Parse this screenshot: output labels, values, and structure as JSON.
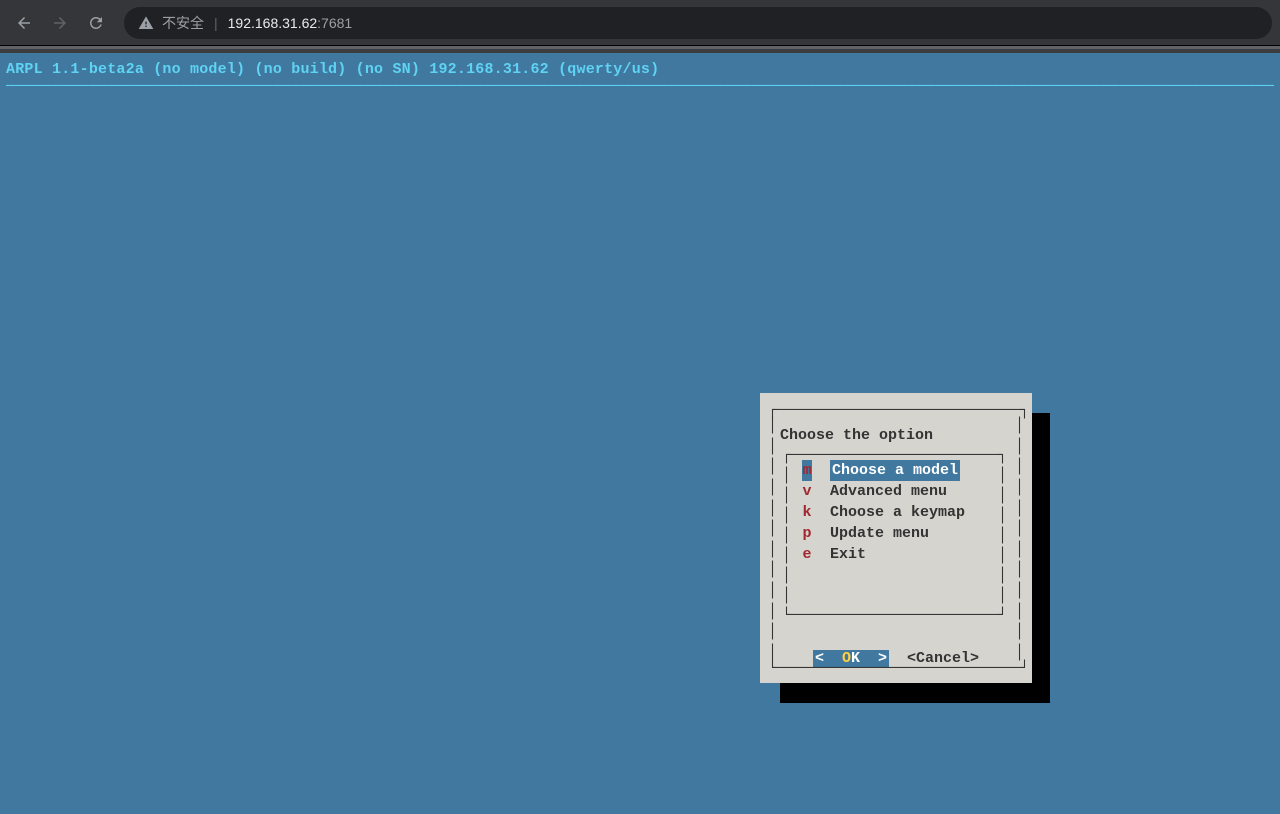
{
  "browser": {
    "insecure_label": "不安全",
    "url_host": "192.168.31.62",
    "url_port": ":7681"
  },
  "terminal": {
    "header_line": "ARPL 1.1-beta2a (no model) (no build) (no SN) 192.168.31.62 (qwerty/us)"
  },
  "dialog": {
    "title": "Choose the option",
    "menu": [
      {
        "key": "m",
        "label": "Choose a model",
        "selected": true
      },
      {
        "key": "v",
        "label": "Advanced menu",
        "selected": false
      },
      {
        "key": "k",
        "label": "Choose a keymap",
        "selected": false
      },
      {
        "key": "p",
        "label": "Update menu",
        "selected": false
      },
      {
        "key": "e",
        "label": "Exit",
        "selected": false
      }
    ],
    "buttons": {
      "ok": "OK",
      "cancel": "<Cancel>"
    }
  }
}
